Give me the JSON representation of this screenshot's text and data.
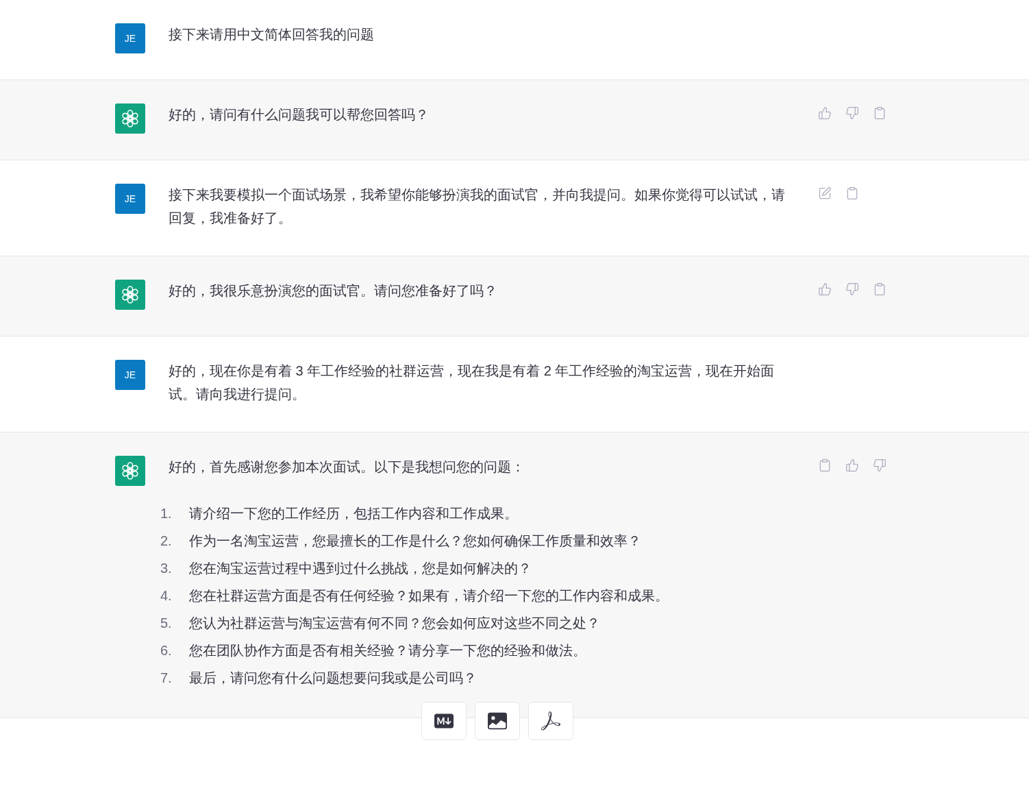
{
  "messages": [
    {
      "kind": "user",
      "avatar": "JE",
      "text": "接下来请用中文简体回答我的问题"
    },
    {
      "kind": "assistant",
      "text": "好的，请问有什么问题我可以帮您回答吗？",
      "actions": [
        {
          "kind": "thumbs_up"
        },
        {
          "kind": "thumbs_down"
        },
        {
          "kind": "copy"
        }
      ]
    },
    {
      "kind": "user",
      "avatar": "JE",
      "text": "接下来我要模拟一个面试场景，我希望你能够扮演我的面试官，并向我提问。如果你觉得可以试试，请回复，我准备好了。",
      "actions": [
        {
          "kind": "edit"
        },
        {
          "kind": "copy"
        }
      ]
    },
    {
      "kind": "assistant",
      "text": "好的，我很乐意扮演您的面试官。请问您准备好了吗？",
      "actions": [
        {
          "kind": "thumbs_up"
        },
        {
          "kind": "thumbs_down"
        },
        {
          "kind": "copy"
        }
      ]
    },
    {
      "kind": "user",
      "avatar": "JE",
      "text": "好的，现在你是有着 3 年工作经验的社群运营，现在我是有着 2 年工作经验的淘宝运营，现在开始面试。请向我进行提问。"
    },
    {
      "kind": "assistant",
      "text": "好的，首先感谢您参加本次面试。以下是我想问您的问题：",
      "actions": [
        {
          "kind": "copy"
        },
        {
          "kind": "thumbs_up"
        },
        {
          "kind": "thumbs_down"
        }
      ],
      "list": [
        {
          "number": "1.",
          "text": "请介绍一下您的工作经历，包括工作内容和工作成果。"
        },
        {
          "number": "2.",
          "text": "作为一名淘宝运营，您最擅长的工作是什么？您如何确保工作质量和效率？"
        },
        {
          "number": "3.",
          "text": "您在淘宝运营过程中遇到过什么挑战，您是如何解决的？"
        },
        {
          "number": "4.",
          "text": "您在社群运营方面是否有任何经验？如果有，请介绍一下您的工作内容和成果。"
        },
        {
          "number": "5.",
          "text": "您认为社群运营与淘宝运营有何不同？您会如何应对这些不同之处？"
        },
        {
          "number": "6.",
          "text": "您在团队协作方面是否有相关经验？请分享一下您的经验和做法。"
        },
        {
          "number": "7.",
          "text": "最后，请问您有什么问题想要问我或是公司吗？"
        }
      ]
    }
  ],
  "export_buttons": [
    {
      "kind": "markdown"
    },
    {
      "kind": "image"
    },
    {
      "kind": "pdf"
    }
  ]
}
